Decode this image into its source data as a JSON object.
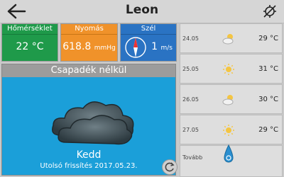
{
  "header": {
    "title": "Leon"
  },
  "tiles": {
    "temperature": {
      "label": "Hőmérséklet",
      "value": "22 °C"
    },
    "pressure": {
      "label": "Nyomás",
      "value": "618.8",
      "unit": "mmHg"
    },
    "wind": {
      "label": "Szél",
      "value": "1",
      "unit": "m/s"
    }
  },
  "main": {
    "condition": "Csapadék nélkül",
    "day": "Kedd",
    "updated": "Utolsó frissítés 2017.05.23."
  },
  "forecast": [
    {
      "date": "24.05",
      "icon": "partly-cloudy-icon",
      "temp": "29 °C"
    },
    {
      "date": "25.05",
      "icon": "sun-icon",
      "temp": "31 °C"
    },
    {
      "date": "26.05",
      "icon": "partly-cloudy-icon",
      "temp": "30 °C"
    },
    {
      "date": "27.05",
      "icon": "sun-icon",
      "temp": "29 °C"
    }
  ],
  "more": {
    "label": "Tovább"
  },
  "colors": {
    "temperature_tile": "#1f9a4a",
    "pressure_tile": "#f0922a",
    "wind_tile": "#2a73c3",
    "main_panel": "#1b9fd9"
  }
}
